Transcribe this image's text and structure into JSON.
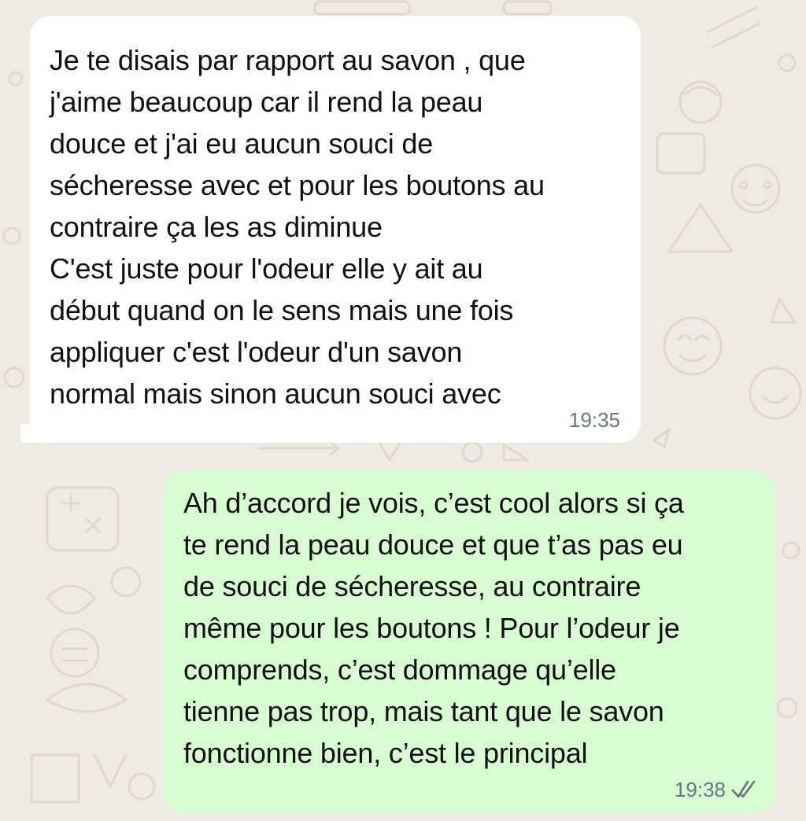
{
  "chat": {
    "messages": [
      {
        "direction": "incoming",
        "text": "Je te disais par rapport au savon , que\nj'aime beaucoup car il rend la peau\ndouce et j'ai eu aucun souci de\nsécheresse avec et pour les boutons au\ncontraire ça les as diminue\nC'est juste pour l'odeur elle y ait au\ndébut quand on le sens mais une fois\nappliquer c'est l'odeur d'un savon\nnormal mais sinon aucun souci avec",
        "time": "19:35"
      },
      {
        "direction": "outgoing",
        "text": "Ah d’accord je vois, c’est cool alors si ça\nte rend la peau douce et que t’as pas eu\nde souci de sécheresse, au contraire\nmême pour les boutons ! Pour l’odeur je\ncomprends, c’est dommage qu’elle\ntienne pas trop, mais tant que le savon\nfonctionne bien, c’est le principal",
        "time": "19:38",
        "status_icon": "double-check-read-icon"
      }
    ]
  },
  "colors": {
    "wallpaper": "#efeae2",
    "incoming_bubble": "#ffffff",
    "outgoing_bubble": "#d9fdd3",
    "timestamp": "#667781",
    "text": "#111111"
  }
}
